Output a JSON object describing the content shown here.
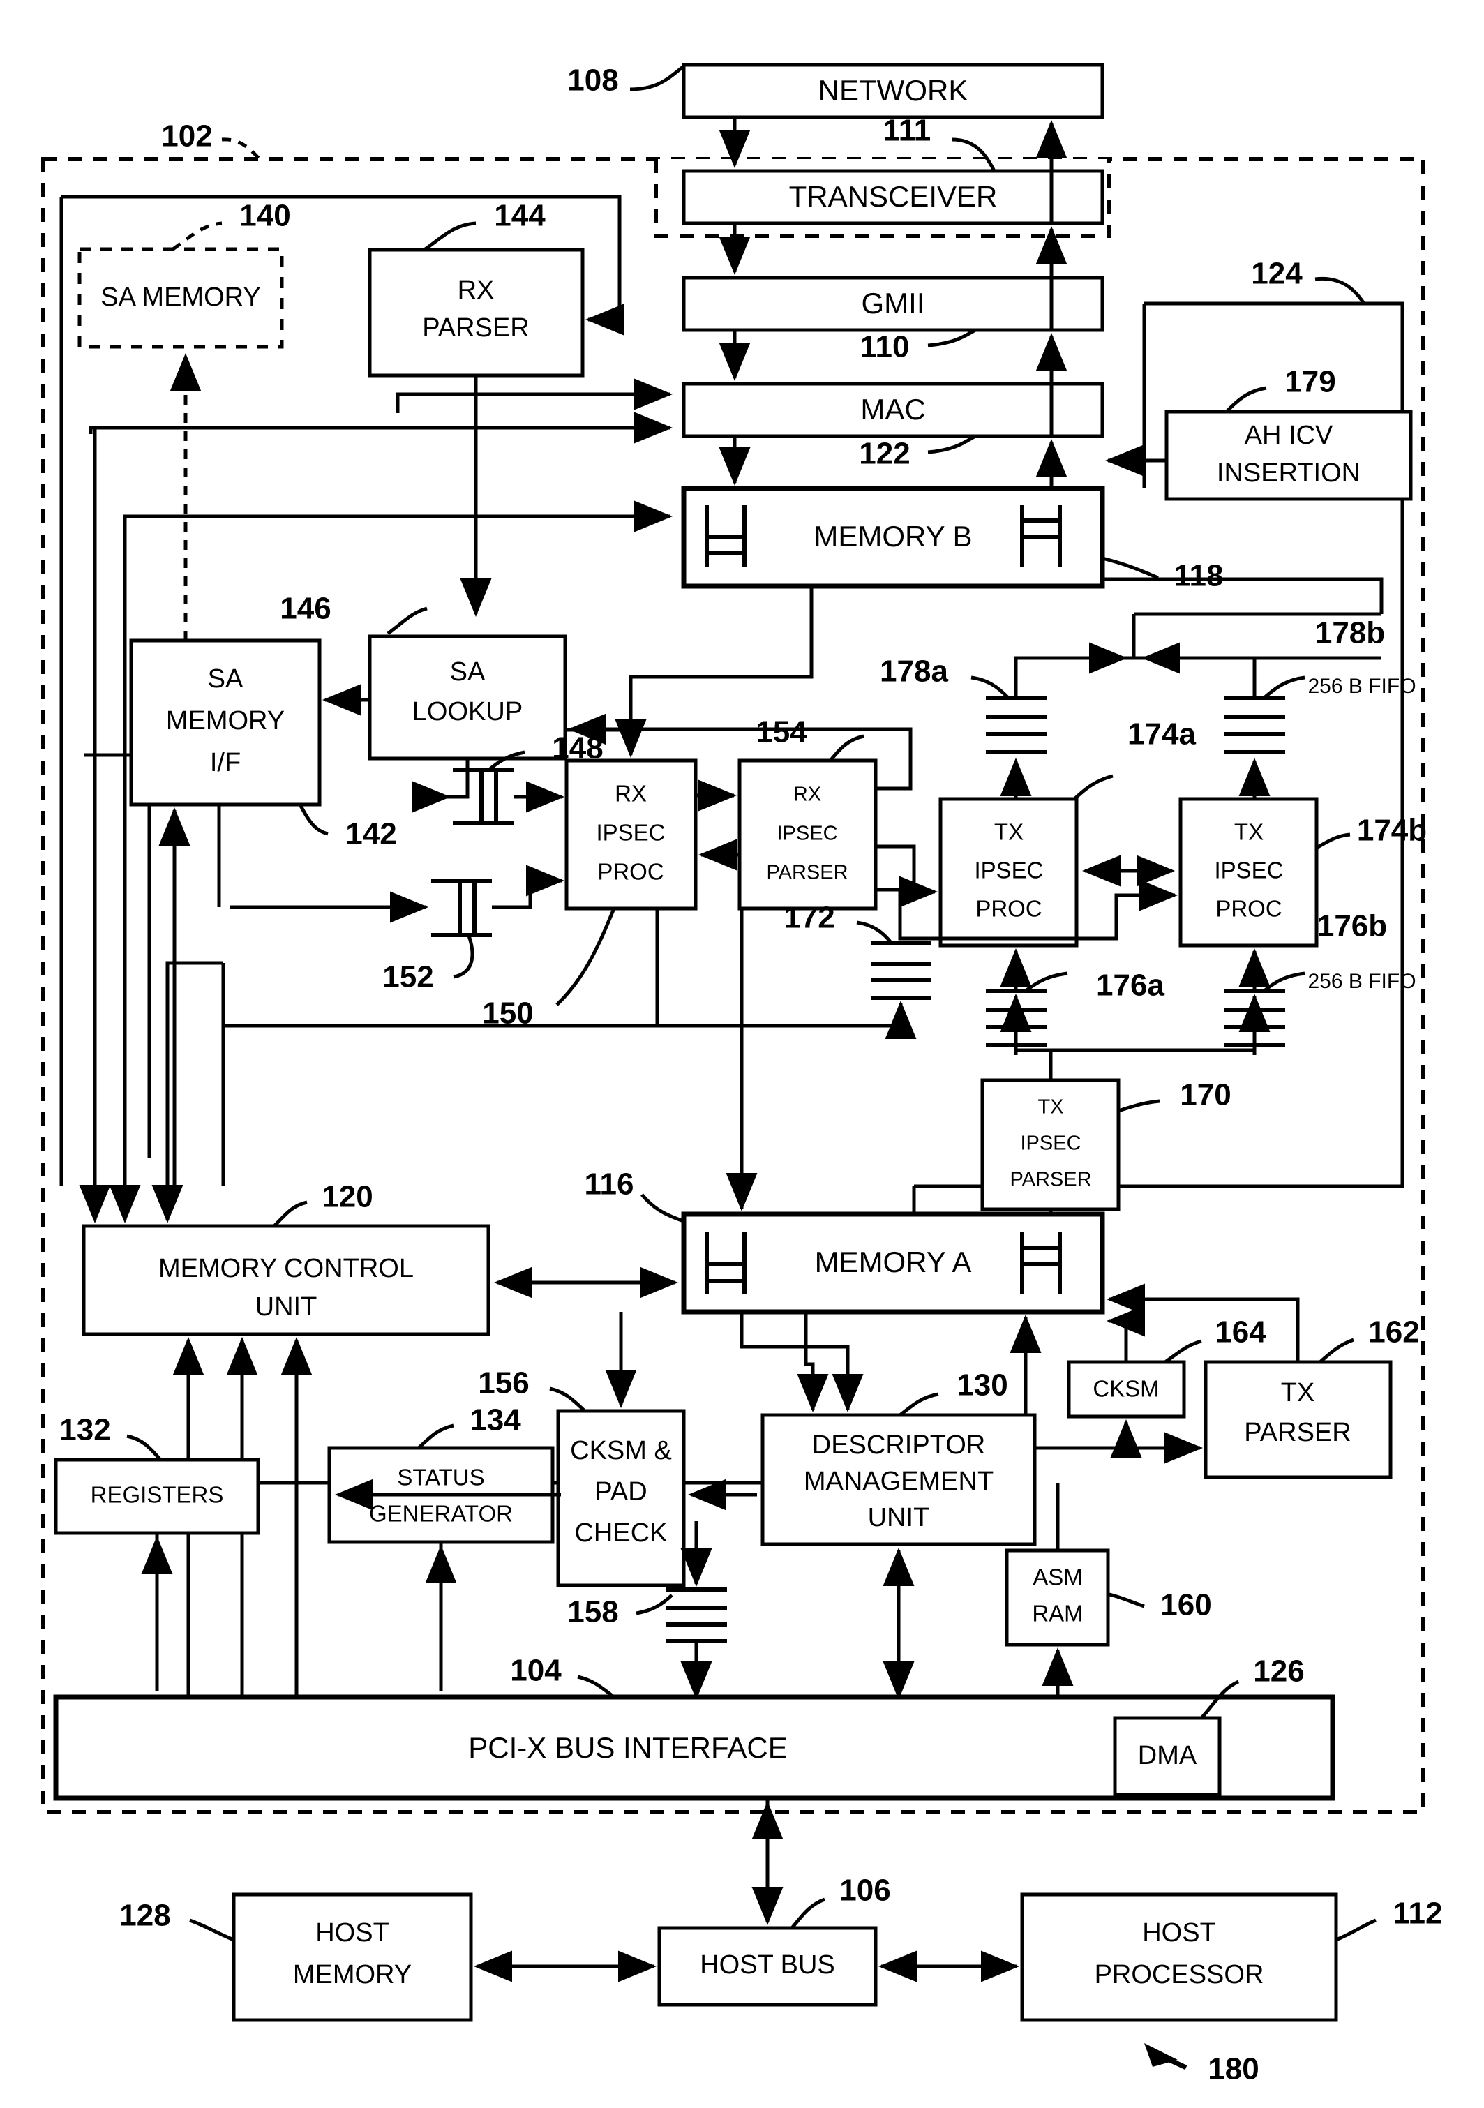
{
  "figure": {
    "figure_number": "180",
    "blocks": {
      "network": {
        "label": "NETWORK",
        "ref": "108"
      },
      "transceiver": {
        "label": "TRANSCEIVER",
        "ref": "111"
      },
      "gmii": {
        "label": "GMII",
        "ref": "110"
      },
      "mac": {
        "label": "MAC",
        "ref": "122"
      },
      "memory_b": {
        "label": "MEMORY B",
        "ref": "118"
      },
      "sa_memory": {
        "label": "SA MEMORY",
        "ref": "140"
      },
      "rx_parser": {
        "label_line1": "RX",
        "label_line2": "PARSER",
        "ref": "144"
      },
      "sa_memory_if": {
        "label_line1": "SA",
        "label_line2": "MEMORY",
        "label_line3": "I/F",
        "ref": "142"
      },
      "sa_lookup": {
        "label_line1": "SA",
        "label_line2": "LOOKUP",
        "ref": "146"
      },
      "rx_ipsec_proc": {
        "label_line1": "RX",
        "label_line2": "IPSEC",
        "label_line3": "PROC",
        "ref": "150"
      },
      "rx_ipsec_parser": {
        "label_line1": "RX",
        "label_line2": "IPSEC",
        "label_line3": "PARSER",
        "ref": "154"
      },
      "tx_ipsec_proc_a": {
        "label_line1": "TX",
        "label_line2": "IPSEC",
        "label_line3": "PROC",
        "ref": "174a"
      },
      "tx_ipsec_proc_b": {
        "label_line1": "TX",
        "label_line2": "IPSEC",
        "label_line3": "PROC",
        "ref": "174b"
      },
      "tx_ipsec_parser": {
        "label_line1": "TX",
        "label_line2": "IPSEC",
        "label_line3": "PARSER",
        "ref": "170"
      },
      "ah_icv_insertion": {
        "label_line1": "AH ICV",
        "label_line2": "INSERTION",
        "ref": "179"
      },
      "memory_control_unit": {
        "label_line1": "MEMORY CONTROL",
        "label_line2": "UNIT",
        "ref": "120"
      },
      "memory_a": {
        "label": "MEMORY A",
        "ref": "116"
      },
      "registers": {
        "label": "REGISTERS",
        "ref": "132"
      },
      "status_generator": {
        "label_line1": "STATUS",
        "label_line2": "GENERATOR",
        "ref": "134"
      },
      "cksm_pad_check": {
        "label_line1": "CKSM &",
        "label_line2": "PAD",
        "label_line3": "CHECK",
        "ref": "156"
      },
      "descriptor_management_unit": {
        "label_line1": "DESCRIPTOR",
        "label_line2": "MANAGEMENT",
        "label_line3": "UNIT",
        "ref": "130"
      },
      "cksm": {
        "label": "CKSM",
        "ref": "164"
      },
      "tx_parser": {
        "label_line1": "TX",
        "label_line2": "PARSER",
        "ref": "162"
      },
      "asm_ram": {
        "label_line1": "ASM",
        "label_line2": "RAM",
        "ref": "160"
      },
      "pci_x_bus_interface": {
        "label": "PCI-X BUS INTERFACE",
        "ref": "104"
      },
      "dma": {
        "label": "DMA",
        "ref": "126"
      },
      "host_memory": {
        "label_line1": "HOST",
        "label_line2": "MEMORY",
        "ref": "128"
      },
      "host_bus": {
        "label": "HOST BUS",
        "ref": "106"
      },
      "host_processor": {
        "label_line1": "HOST",
        "label_line2": "PROCESSOR",
        "ref": "112"
      }
    },
    "fifos": {
      "f148": {
        "ref": "148"
      },
      "f152": {
        "ref": "152"
      },
      "f172": {
        "ref": "172"
      },
      "f176a": {
        "ref": "176a"
      },
      "f176b": {
        "ref": "176b",
        "note": "256 B FIFO"
      },
      "f178a": {
        "ref": "178a"
      },
      "f178b": {
        "ref": "178b",
        "note": "256 B FIFO"
      },
      "f158": {
        "ref": "158"
      }
    },
    "regions": {
      "nic_boundary": {
        "ref": "102"
      },
      "tx_path_boundary": {
        "ref": "124"
      }
    }
  }
}
